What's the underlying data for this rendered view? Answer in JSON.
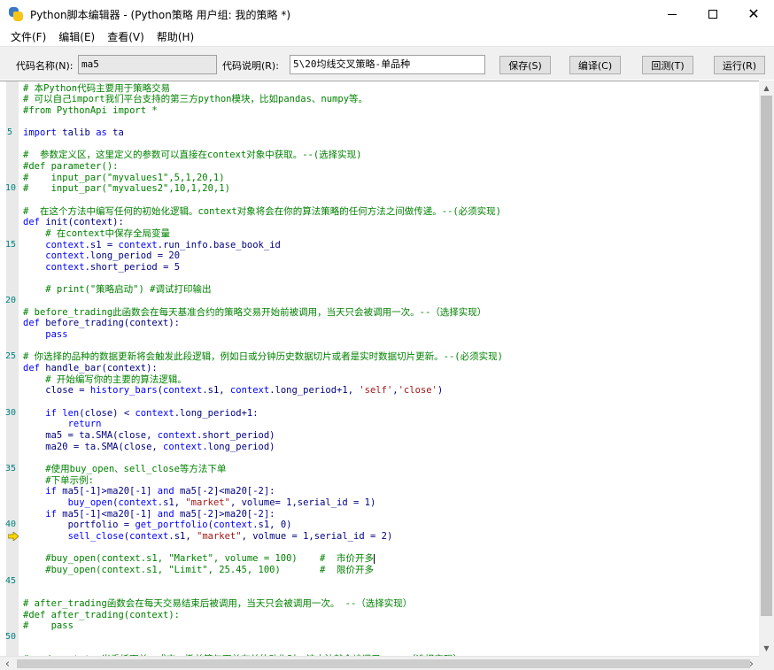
{
  "window": {
    "title": "Python脚本编辑器 - (Python策略 用户组: 我的策略 *)"
  },
  "menu": {
    "items": [
      "文件(F)",
      "编辑(E)",
      "查看(V)",
      "帮助(H)"
    ]
  },
  "toolbar": {
    "code_name_label": "代码名称(N):",
    "code_name_value": "ma5",
    "code_desc_label": "代码说明(R):",
    "code_desc_value": "5\\20均线交叉策略-单品种",
    "save_label": "保存(S)",
    "compile_label": "编译(C)",
    "backtest_label": "回测(T)",
    "run_label": "运行(R)"
  },
  "editor": {
    "line_numbers": [
      {
        "label": "5",
        "row": 4
      },
      {
        "label": "10",
        "row": 9
      },
      {
        "label": "15",
        "row": 14
      },
      {
        "label": "20",
        "row": 19
      },
      {
        "label": "25",
        "row": 24
      },
      {
        "label": "30",
        "row": 29
      },
      {
        "label": "35",
        "row": 34
      },
      {
        "label": "40",
        "row": 39
      },
      {
        "label": "45",
        "row": 44
      },
      {
        "label": "50",
        "row": 49
      }
    ],
    "arrow_row": 40,
    "lines": [
      [
        [
          "c-comment",
          "# 本Python代码主要用于策略交易"
        ]
      ],
      [
        [
          "c-comment",
          "# 可以自己import我们平台支持的第三方python模块，比如pandas、numpy等。"
        ]
      ],
      [
        [
          "c-comment",
          "#from PythonApi import *"
        ]
      ],
      [],
      [
        [
          "c-keyword",
          "import"
        ],
        [
          "c-default",
          " talib "
        ],
        [
          "c-keyword",
          "as"
        ],
        [
          "c-default",
          " ta"
        ]
      ],
      [],
      [
        [
          "c-comment",
          "#  参数定义区，这里定义的参数可以直接在context对象中获取。--(选择实现)"
        ]
      ],
      [
        [
          "c-comment",
          "#def parameter():"
        ]
      ],
      [
        [
          "c-comment",
          "#    input_par(\"myvalues1\",5,1,20,1)"
        ]
      ],
      [
        [
          "c-comment",
          "#    input_par(\"myvalues2\",10,1,20,1)"
        ]
      ],
      [],
      [
        [
          "c-comment",
          "#  在这个方法中编写任何的初始化逻辑。context对象将会在你的算法策略的任何方法之间做传递。--(必须实现)"
        ]
      ],
      [
        [
          "c-keyword",
          "def"
        ],
        [
          "c-default",
          " init(context):"
        ]
      ],
      [
        [
          "c-comment",
          "    # 在context中保存全局变量"
        ]
      ],
      [
        [
          "c-default",
          "    "
        ],
        [
          "c-ctx",
          "context"
        ],
        [
          "c-default",
          ".s1 = "
        ],
        [
          "c-ctx",
          "context"
        ],
        [
          "c-default",
          ".run_info.base_book_id"
        ]
      ],
      [
        [
          "c-default",
          "    "
        ],
        [
          "c-ctx",
          "context"
        ],
        [
          "c-default",
          ".long_period = 20"
        ]
      ],
      [
        [
          "c-default",
          "    "
        ],
        [
          "c-ctx",
          "context"
        ],
        [
          "c-default",
          ".short_period = 5"
        ]
      ],
      [],
      [
        [
          "c-comment",
          "    # print(\"策略启动\") #调试打印输出"
        ]
      ],
      [],
      [
        [
          "c-comment",
          "# before_trading此函数会在每天基准合约的策略交易开始前被调用，当天只会被调用一次。--（选择实现）"
        ]
      ],
      [
        [
          "c-keyword",
          "def"
        ],
        [
          "c-default",
          " before_trading(context):"
        ]
      ],
      [
        [
          "c-keyword",
          "    pass"
        ]
      ],
      [],
      [
        [
          "c-comment",
          "# 你选择的品种的数据更新将会触发此段逻辑，例如日或分钟历史数据切片或者是实时数据切片更新。--(必须实现)"
        ]
      ],
      [
        [
          "c-keyword",
          "def"
        ],
        [
          "c-default",
          " handle_bar(context):"
        ]
      ],
      [
        [
          "c-comment",
          "    # 开始编写你的主要的算法逻辑。"
        ]
      ],
      [
        [
          "c-default",
          "    close = "
        ],
        [
          "c-ctx",
          "history_bars"
        ],
        [
          "c-default",
          "("
        ],
        [
          "c-ctx",
          "context"
        ],
        [
          "c-default",
          ".s1, "
        ],
        [
          "c-ctx",
          "context"
        ],
        [
          "c-default",
          ".long_period+1, "
        ],
        [
          "c-str",
          "'self'"
        ],
        [
          "c-default",
          ","
        ],
        [
          "c-str",
          "'close'"
        ],
        [
          "c-default",
          ")"
        ]
      ],
      [],
      [
        [
          "c-default",
          "    "
        ],
        [
          "c-keyword",
          "if"
        ],
        [
          "c-default",
          " "
        ],
        [
          "c-ctx",
          "len"
        ],
        [
          "c-default",
          "(close) < "
        ],
        [
          "c-ctx",
          "context"
        ],
        [
          "c-default",
          ".long_period+1:"
        ]
      ],
      [
        [
          "c-keyword",
          "        return"
        ]
      ],
      [
        [
          "c-default",
          "    ma5 = ta.SMA(close, "
        ],
        [
          "c-ctx",
          "context"
        ],
        [
          "c-default",
          ".short_period)"
        ]
      ],
      [
        [
          "c-default",
          "    ma20 = ta.SMA(close, "
        ],
        [
          "c-ctx",
          "context"
        ],
        [
          "c-default",
          ".long_period)"
        ]
      ],
      [],
      [
        [
          "c-comment",
          "    #使用buy_open、sell_close等方法下单"
        ]
      ],
      [
        [
          "c-comment",
          "    #下单示例:"
        ]
      ],
      [
        [
          "c-default",
          "    "
        ],
        [
          "c-keyword",
          "if"
        ],
        [
          "c-default",
          " ma5[-1]>ma20[-1] "
        ],
        [
          "c-keyword",
          "and"
        ],
        [
          "c-default",
          " ma5[-2]<ma20[-2]:"
        ]
      ],
      [
        [
          "c-default",
          "        "
        ],
        [
          "c-ctx",
          "buy_open"
        ],
        [
          "c-default",
          "("
        ],
        [
          "c-ctx",
          "context"
        ],
        [
          "c-default",
          ".s1, "
        ],
        [
          "c-str",
          "\"market\""
        ],
        [
          "c-default",
          ", volume= 1,serial_id = 1)"
        ]
      ],
      [
        [
          "c-default",
          "    "
        ],
        [
          "c-keyword",
          "if"
        ],
        [
          "c-default",
          " ma5[-1]<ma20[-1] "
        ],
        [
          "c-keyword",
          "and"
        ],
        [
          "c-default",
          " ma5[-2]>ma20[-2]:"
        ]
      ],
      [
        [
          "c-default",
          "        portfolio = "
        ],
        [
          "c-ctx",
          "get_portfolio"
        ],
        [
          "c-default",
          "("
        ],
        [
          "c-ctx",
          "context"
        ],
        [
          "c-default",
          ".s1, 0)"
        ]
      ],
      [
        [
          "c-default",
          "        "
        ],
        [
          "c-ctx",
          "sell_close"
        ],
        [
          "c-default",
          "("
        ],
        [
          "c-ctx",
          "context"
        ],
        [
          "c-default",
          ".s1, "
        ],
        [
          "c-str",
          "\"market\""
        ],
        [
          "c-default",
          ", volmue = 1,serial_id = 2)"
        ]
      ],
      [],
      [
        [
          "c-comment",
          "    #buy_open(context.s1, \"Market\", volume = 100)    #  市价开多"
        ]
      ],
      [
        [
          "c-comment",
          "    #buy_open(context.s1, \"Limit\", 25.45, 100)       #  限价开多"
        ]
      ],
      [],
      [],
      [
        [
          "c-comment",
          "# after_trading函数会在每天交易结束后被调用，当天只会被调用一次。 --（选择实现）"
        ]
      ],
      [
        [
          "c-comment",
          "#def after_trading(context):"
        ]
      ],
      [
        [
          "c-comment",
          "#    pass"
        ]
      ],
      [],
      [],
      [
        [
          "c-comment",
          "# order_status当委托下单，成交，撤单等与下单有关的动作时，该方法就会被调用。---（选择实现）"
        ]
      ]
    ],
    "cursor": {
      "row": 42
    }
  },
  "colors": {
    "comment": "#008000",
    "keyword": "#0000ff",
    "string": "#a31515",
    "line_number": "#008080",
    "arrow_marker": "#ffd700"
  }
}
